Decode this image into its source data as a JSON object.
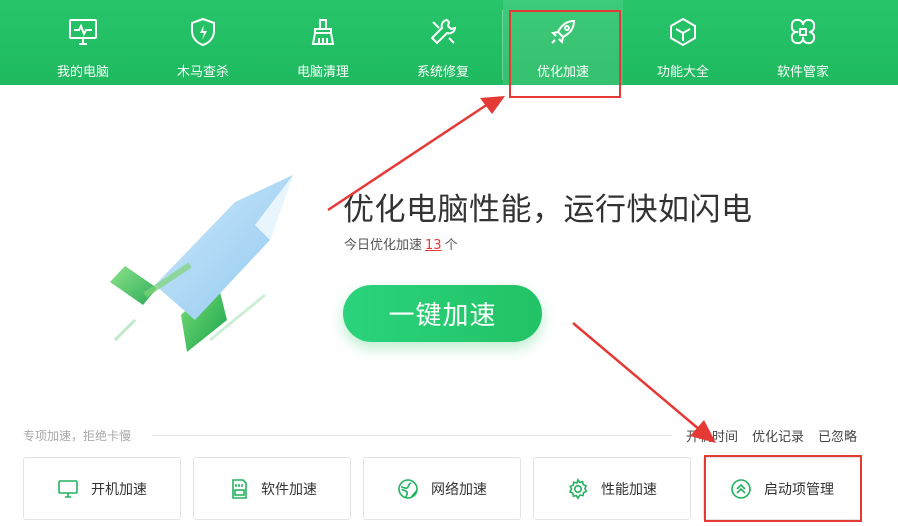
{
  "nav": {
    "items": [
      {
        "label": "我的电脑",
        "icon": "monitor-icon"
      },
      {
        "label": "木马查杀",
        "icon": "shield-icon"
      },
      {
        "label": "电脑清理",
        "icon": "broom-icon"
      },
      {
        "label": "系统修复",
        "icon": "wrench-icon"
      },
      {
        "label": "优化加速",
        "icon": "rocket-icon",
        "active": true
      },
      {
        "label": "功能大全",
        "icon": "cube-icon"
      },
      {
        "label": "软件管家",
        "icon": "apps-icon"
      }
    ]
  },
  "hero": {
    "headline": "优化电脑性能，运行快如闪电",
    "sub_prefix": "今日优化加速",
    "sub_count": "13",
    "sub_suffix": "个",
    "button_label": "一键加速",
    "icon": "rocket-illustration"
  },
  "section": {
    "label": "专项加速，拒绝卡慢",
    "links": [
      "开机时间",
      "优化记录",
      "已忽略"
    ]
  },
  "cards": [
    {
      "label": "开机加速",
      "icon": "monitor-icon"
    },
    {
      "label": "软件加速",
      "icon": "sd-card-icon"
    },
    {
      "label": "网络加速",
      "icon": "globe-icon"
    },
    {
      "label": "性能加速",
      "icon": "gear-icon"
    },
    {
      "label": "启动项管理",
      "icon": "chevrons-up-icon"
    }
  ],
  "colors": {
    "brand_green": "#22c265",
    "annotation_red": "#e53935"
  }
}
